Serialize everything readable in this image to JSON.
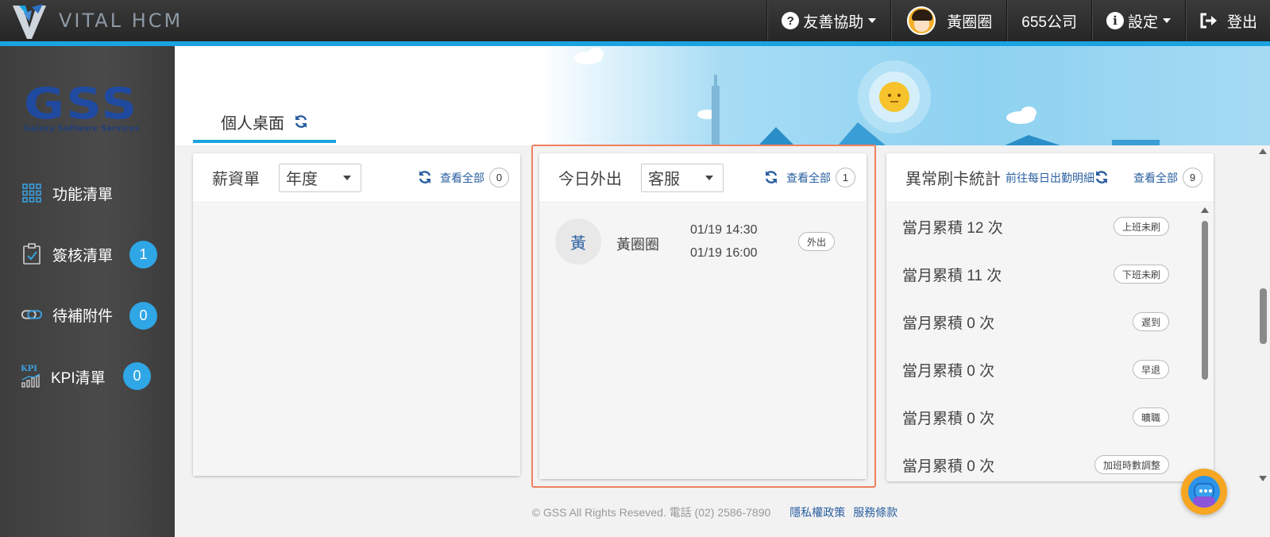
{
  "header": {
    "brand": "VITAL HCM",
    "help_label": "友善協助",
    "user_name": "黃圈圈",
    "company": "655公司",
    "settings_label": "設定",
    "logout_label": "登出"
  },
  "sidebar": {
    "logo_text": "GSS",
    "logo_subtitle": "Galaxy Software Services",
    "items": [
      {
        "label": "功能清單",
        "badge": null
      },
      {
        "label": "簽核清單",
        "badge": "1"
      },
      {
        "label": "待補附件",
        "badge": "0"
      },
      {
        "label": "KPI清單",
        "badge": "0"
      }
    ],
    "kpi_icon_text": "KPI"
  },
  "tabs": [
    {
      "label": "個人桌面",
      "active": true
    }
  ],
  "cards": {
    "payslip": {
      "title": "薪資單",
      "select_value": "年度",
      "view_all": "查看全部",
      "count": "0"
    },
    "outing": {
      "title": "今日外出",
      "select_value": "客服",
      "view_all": "查看全部",
      "count": "1",
      "entries": [
        {
          "avatar_char": "黃",
          "name": "黃圈圈",
          "time_start": "01/19 14:30",
          "time_end": "01/19 16:00",
          "status": "外出"
        }
      ]
    },
    "abnormal": {
      "title": "異常刷卡統計",
      "link": "前往每日出勤明細",
      "view_all": "查看全部",
      "count": "9",
      "rows": [
        {
          "text": "當月累積 12 次",
          "tag": "上班未刷"
        },
        {
          "text": "當月累積 11 次",
          "tag": "下班未刷"
        },
        {
          "text": "當月累積 0 次",
          "tag": "遲到"
        },
        {
          "text": "當月累積 0 次",
          "tag": "早退"
        },
        {
          "text": "當月累積 0 次",
          "tag": "曠職"
        },
        {
          "text": "當月累積 0 次",
          "tag": "加班時數調整"
        }
      ]
    }
  },
  "footer": {
    "copyright": "© GSS All Rights Reseved. 電話 (02) 2586-7890",
    "privacy": "隱私權政策",
    "terms": "服務條款"
  },
  "colors": {
    "accent": "#1aa3e0",
    "badge": "#2fa6e6",
    "link": "#2a5fa0",
    "highlight": "#f0805e"
  }
}
